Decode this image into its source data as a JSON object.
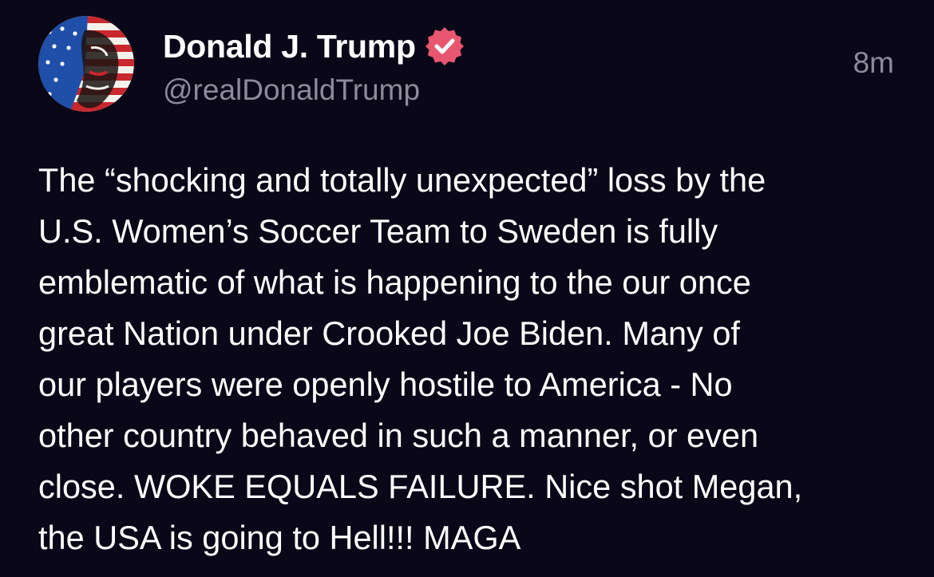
{
  "post": {
    "author": {
      "display_name": "Donald J. Trump",
      "handle": "@realDonaldTrump",
      "verified": true,
      "avatar_icon": "avatar-flag-portrait"
    },
    "timestamp": "8m",
    "body_lines": [
      "The “shocking and totally unexpected” loss by the",
      "U.S. Women’s Soccer Team to Sweden is fully",
      "emblematic of what is happening to the our once",
      "great Nation under Crooked Joe Biden. Many of",
      "our players were openly hostile to America - No",
      "other country behaved in such a manner, or even",
      "close. WOKE EQUALS FAILURE. Nice shot Megan,",
      "the USA is going to Hell!!! MAGA"
    ]
  },
  "colors": {
    "background": "#0a0818",
    "text_primary": "#ffffff",
    "text_secondary": "#8d8b99",
    "verified_badge": "#e8566f"
  }
}
